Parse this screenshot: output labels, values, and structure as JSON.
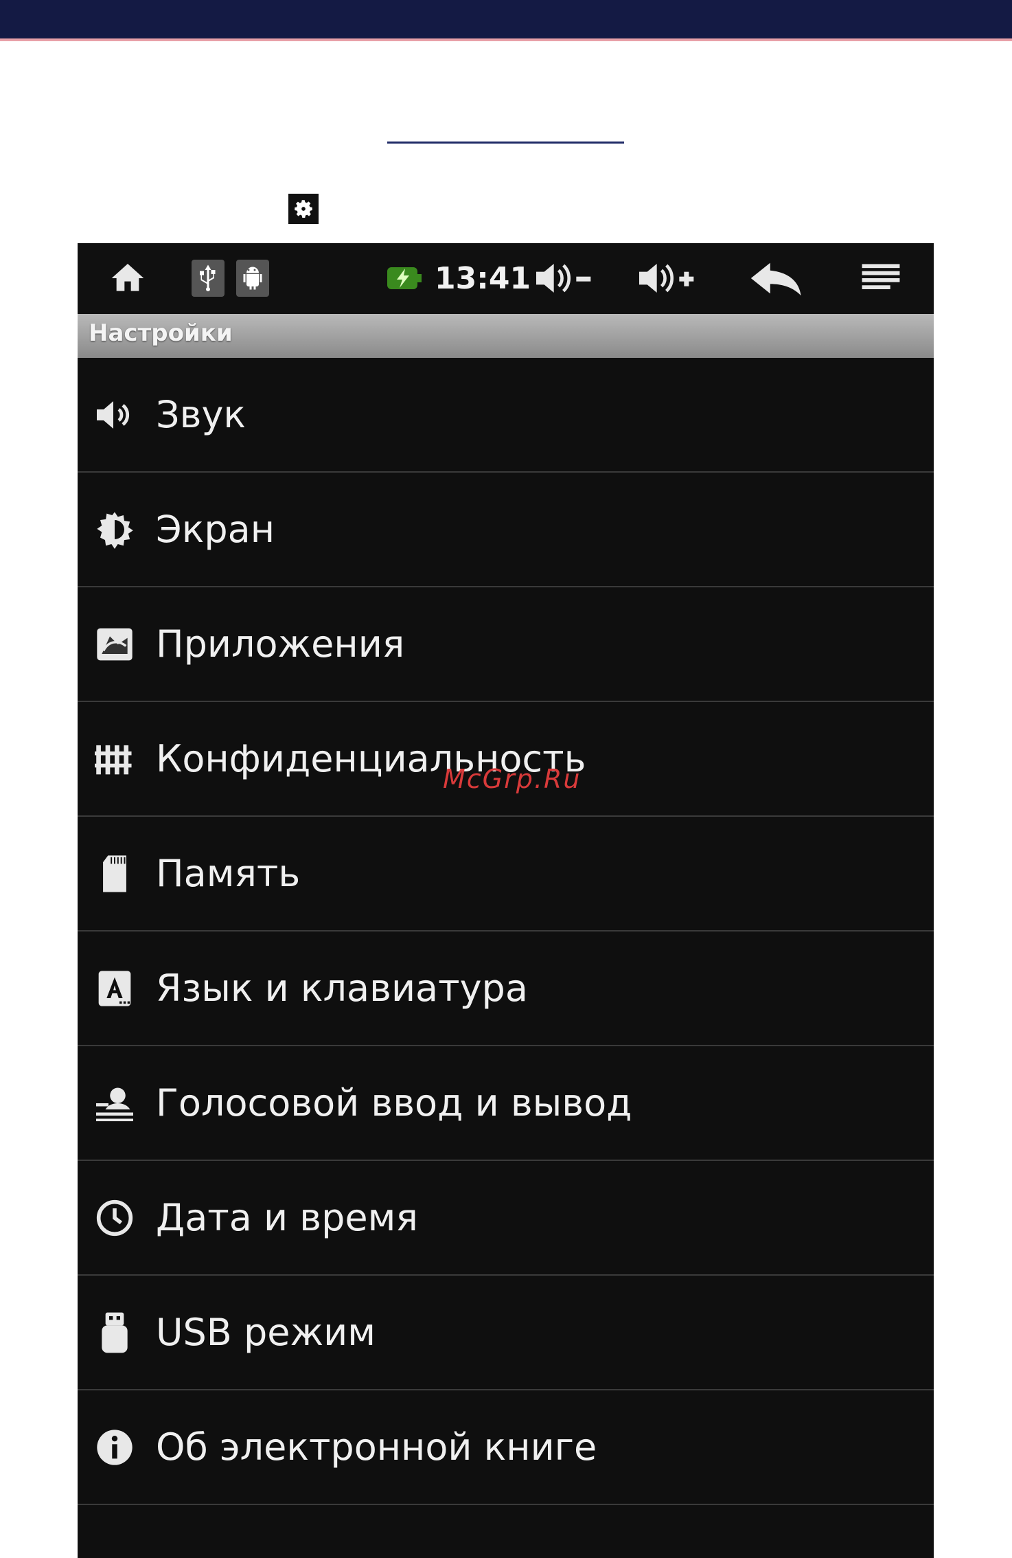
{
  "statusbar": {
    "time": "13:41",
    "icons": [
      "home-icon",
      "usb-icon",
      "android-icon",
      "battery-icon",
      "volume-down-icon",
      "volume-up-icon",
      "back-icon",
      "menu-icon"
    ]
  },
  "title": "Настройки",
  "items": [
    {
      "label": "Звук",
      "icon": "speaker-icon"
    },
    {
      "label": "Экран",
      "icon": "brightness-icon"
    },
    {
      "label": "Приложения",
      "icon": "apps-icon"
    },
    {
      "label": "Конфиденциальность",
      "icon": "privacy-icon"
    },
    {
      "label": "Память",
      "icon": "sdcard-icon"
    },
    {
      "label": "Язык и клавиатура",
      "icon": "language-icon"
    },
    {
      "label": "Голосовой ввод и вывод",
      "icon": "voice-icon"
    },
    {
      "label": "Дата и время",
      "icon": "clock-icon"
    },
    {
      "label": "USB режим",
      "icon": "usb-drive-icon"
    },
    {
      "label": "Об электронной книге",
      "icon": "info-icon"
    }
  ],
  "watermark": "McGrp.Ru",
  "colors": {
    "topbar": "#141a44",
    "device_bg": "#0f0f0f",
    "watermark": "#d83a3a"
  }
}
